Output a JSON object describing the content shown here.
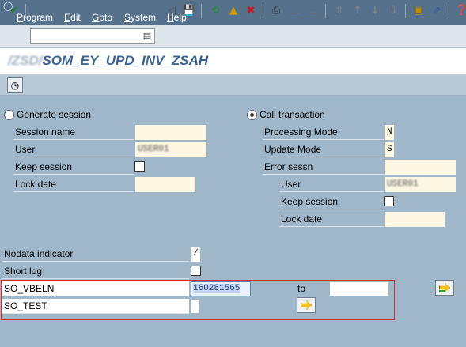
{
  "menubar": {
    "items": [
      "Program",
      "Edit",
      "Goto",
      "System",
      "Help"
    ],
    "underlined": [
      "P",
      "E",
      "G",
      "S",
      "H"
    ]
  },
  "toolbar": {
    "command_field_value": "",
    "icons": [
      "enter-icon",
      "command-history-icon",
      "back-icon",
      "save-icon",
      "back-green-icon",
      "exit-icon",
      "cancel-icon",
      "print-icon",
      "find-icon",
      "find-next-icon",
      "first-page-icon",
      "previous-page-icon",
      "next-page-icon",
      "last-page-icon",
      "new-session-icon",
      "shortcut-icon",
      "help-icon"
    ]
  },
  "title": {
    "prefix_blurred": "/ZSD/",
    "text": "SOM_EY_UPD_INV_ZSAH"
  },
  "apptoolbar": {
    "execute_icon": "execute-clock-icon"
  },
  "left_group": {
    "radio_label": "Generate session",
    "selected": false,
    "fields": {
      "session_name": {
        "label": "Session name",
        "value": ""
      },
      "user": {
        "label": "User",
        "value": "USER01"
      },
      "keep_session": {
        "label": "Keep session",
        "checked": false
      },
      "lock_date": {
        "label": "Lock date",
        "value": ""
      }
    }
  },
  "right_group": {
    "radio_label": "Call transaction",
    "selected": true,
    "fields": {
      "processing_mode": {
        "label": "Processing Mode",
        "value": "N"
      },
      "update_mode": {
        "label": "Update Mode",
        "value": "S"
      },
      "error_sessn": {
        "label": "Error sessn",
        "value": ""
      },
      "user": {
        "label": "User",
        "value": "USER01"
      },
      "keep_session": {
        "label": "Keep session",
        "checked": false
      },
      "lock_date": {
        "label": "Lock date",
        "value": ""
      }
    }
  },
  "options": {
    "nodata": {
      "label": "Nodata indicator",
      "value": "/"
    },
    "short_log": {
      "label": "Short log",
      "checked": false
    }
  },
  "selection": {
    "so_vbeln": {
      "label": "SO_VBELN",
      "low": "160281565",
      "to_label": "to",
      "high": ""
    },
    "so_test": {
      "label": "SO_TEST",
      "value": ""
    }
  },
  "colors": {
    "background": "#9fb7c9",
    "menubar": "#56718c",
    "title_text": "#3b6496",
    "input_bg": "#fbf7e3",
    "highlight_border": "#d73030"
  }
}
